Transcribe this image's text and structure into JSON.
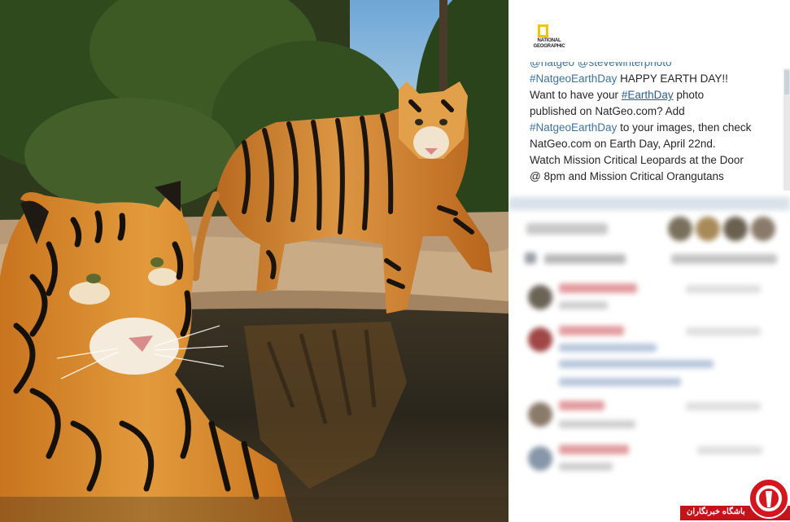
{
  "photo": {
    "subject": "two tigers by a waterhole"
  },
  "brand": {
    "logo_line1": "NATIONAL",
    "logo_line2": "GEOGRAPHIC"
  },
  "caption": {
    "lines": [
      {
        "segments": [
          {
            "text": "@natgeo @stevewinterphoto",
            "type": "tag"
          }
        ]
      },
      {
        "segments": [
          {
            "text": "#NatgeoEarthDay",
            "type": "tag"
          },
          {
            "text": " HAPPY EARTH DAY!!",
            "type": "text"
          }
        ]
      },
      {
        "segments": [
          {
            "text": "Want to have your ",
            "type": "text"
          },
          {
            "text": "#EarthDay",
            "type": "tag-underline"
          },
          {
            "text": " photo",
            "type": "text"
          }
        ]
      },
      {
        "segments": [
          {
            "text": "published on NatGeo.com? Add",
            "type": "text"
          }
        ]
      },
      {
        "segments": [
          {
            "text": "#NatgeoEarthDay",
            "type": "tag"
          },
          {
            "text": " to your images, then check",
            "type": "text"
          }
        ]
      },
      {
        "segments": [
          {
            "text": "NatGeo.com on Earth Day, April 22nd.",
            "type": "text"
          }
        ]
      },
      {
        "segments": [
          {
            "text": "Watch Mission Critical Leopards at the Door",
            "type": "text"
          }
        ]
      },
      {
        "segments": [
          {
            "text": "@ 8pm and Mission Critical Orangutans",
            "type": "text"
          }
        ]
      }
    ]
  },
  "watermark": {
    "text": "باشگاه خبرنگاران"
  },
  "colors": {
    "tag": "#3f729b",
    "badge_red": "#c4131b",
    "logo_yellow": "#f5c400"
  }
}
